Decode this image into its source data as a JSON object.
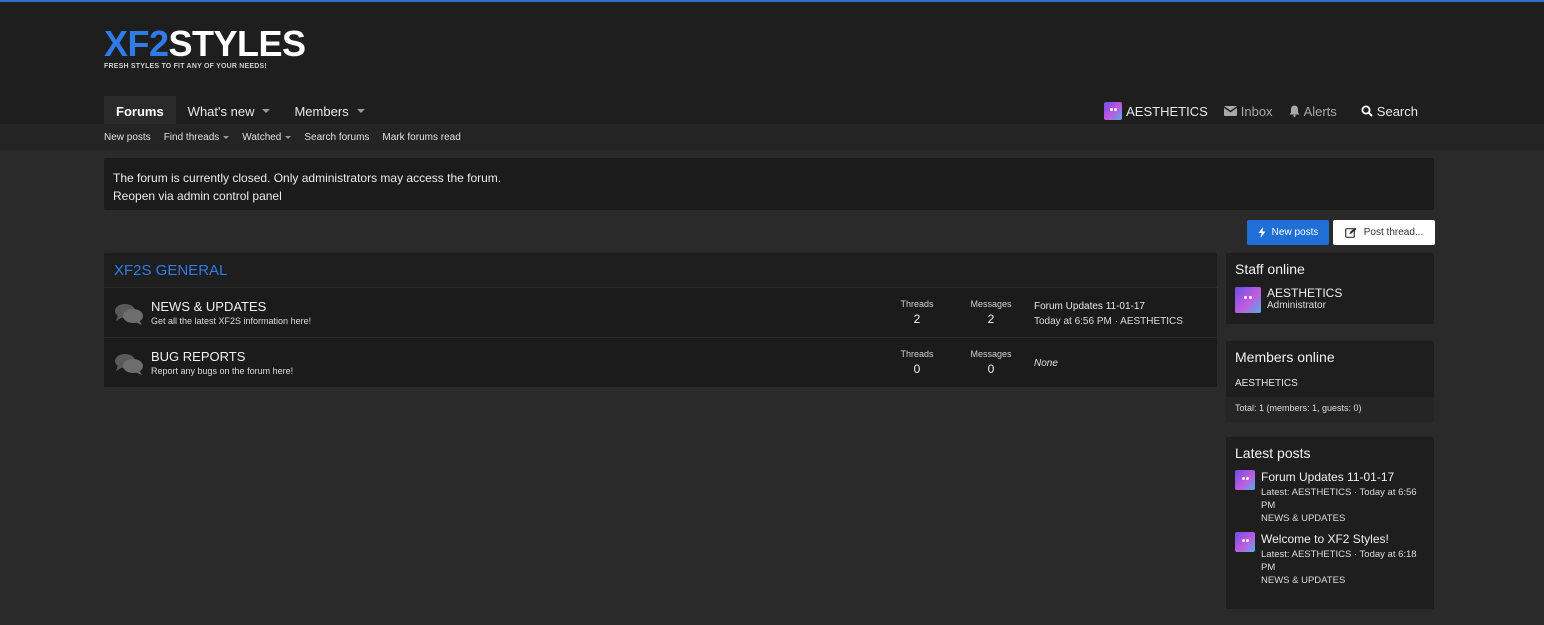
{
  "header": {
    "logo_part1": "XF2",
    "logo_part2": "STYLES",
    "tagline": "FRESH STYLES TO FIT ANY OF YOUR NEEDS!"
  },
  "nav": {
    "tabs": [
      {
        "label": "Forums",
        "active": true
      },
      {
        "label": "What's new",
        "dropdown": true
      },
      {
        "label": "Members",
        "dropdown": true
      }
    ],
    "user": {
      "username": "AESTHETICS",
      "inbox_label": "Inbox",
      "alerts_label": "Alerts",
      "search_label": "Search"
    }
  },
  "subnav": {
    "items": [
      {
        "label": "New posts"
      },
      {
        "label": "Find threads",
        "dropdown": true
      },
      {
        "label": "Watched",
        "dropdown": true
      },
      {
        "label": "Search forums"
      },
      {
        "label": "Mark forums read"
      }
    ]
  },
  "notice": {
    "line1": "The forum is currently closed. Only administrators may access the forum.",
    "line2": "Reopen via admin control panel"
  },
  "buttons": {
    "new_posts": "New posts",
    "post_thread": "Post thread..."
  },
  "category": {
    "title": "XF2S GENERAL",
    "nodes": [
      {
        "title": "NEWS & UPDATES",
        "description": "Get all the latest XF2S information here!",
        "threads_label": "Threads",
        "threads": "2",
        "messages_label": "Messages",
        "messages": "2",
        "last_post_title": "Forum Updates 11-01-17",
        "last_post_meta": "Today at 6:56 PM · AESTHETICS"
      },
      {
        "title": "BUG REPORTS",
        "description": "Report any bugs on the forum here!",
        "threads_label": "Threads",
        "threads": "0",
        "messages_label": "Messages",
        "messages": "0",
        "last_post_none": "None"
      }
    ]
  },
  "sidebar": {
    "staff": {
      "title": "Staff online",
      "name": "AESTHETICS",
      "role": "Administrator"
    },
    "members": {
      "title": "Members online",
      "list": "AESTHETICS",
      "total": "Total: 1 (members: 1, guests: 0)"
    },
    "latest": {
      "title": "Latest posts",
      "items": [
        {
          "title": "Forum Updates 11-01-17",
          "meta": "Latest: AESTHETICS · Today at 6:56 PM",
          "forum": "NEWS & UPDATES"
        },
        {
          "title": "Welcome to XF2 Styles!",
          "meta": "Latest: AESTHETICS · Today at 6:18 PM",
          "forum": "NEWS & UPDATES"
        }
      ]
    }
  },
  "colors": {
    "accent": "#2f7be8",
    "primary_button": "#1f6fd6",
    "background": "#2a2a2a",
    "panel": "#1b1b1b"
  }
}
